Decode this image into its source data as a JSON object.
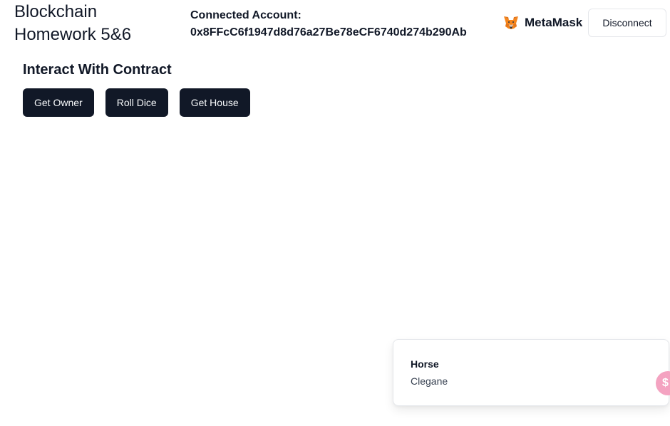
{
  "header": {
    "app_title": "Blockchain Homework 5&6",
    "account_label": "Connected Account:",
    "account_address": "0x8FFcC6f1947d8d76a27Be78eCF6740d274b290Ab",
    "wallet_name": "MetaMask",
    "wallet_icon": "metamask-fox-icon",
    "disconnect_label": "Disconnect"
  },
  "main": {
    "section_title": "Interact With Contract",
    "buttons": [
      {
        "label": "Get Owner"
      },
      {
        "label": "Roll Dice"
      },
      {
        "label": "Get House"
      }
    ]
  },
  "toast": {
    "title": "Horse",
    "description": "Clegane"
  },
  "floating_widget": {
    "icon": "dollar-coin-icon",
    "glyph": "$"
  },
  "colors": {
    "primary_button_bg": "#111827",
    "primary_button_text": "#f8fafc",
    "border": "#e5e7eb",
    "floating_icon_bg": "#f4a3c1"
  }
}
